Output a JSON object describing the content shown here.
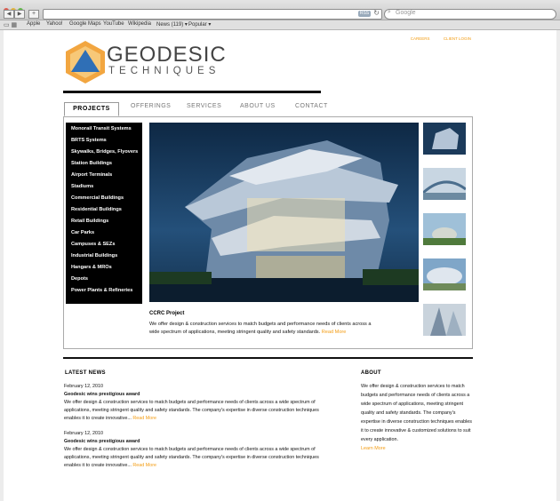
{
  "browser": {
    "search_placeholder": "Google",
    "rss_label": "RSS",
    "bookmarks": [
      "Apple",
      "Yahoo!",
      "Google Maps",
      "YouTube",
      "Wikipedia",
      "News (119) ▾",
      "Popular ▾"
    ]
  },
  "site": {
    "top_links": [
      "CAREERS",
      "CLIENT LOGIN"
    ],
    "brand_line1": "GEODESIC",
    "brand_line2": "TECHNIQUES",
    "colors": {
      "accent": "#f39c12",
      "logo_blue": "#2f6fb6",
      "logo_orange": "#f2a640"
    }
  },
  "tabs": [
    "PROJECTS",
    "OFFERINGS",
    "SERVICES",
    "ABOUT US",
    "CONTACT"
  ],
  "sidenav": [
    "Monorail Transit Systems",
    "BRTS Systems",
    "Skywalks, Bridges, Flyovers",
    "Station Buildings",
    "Airport Terminals",
    "Stadiums",
    "Commercial Buildings",
    "Residential Buildings",
    "Retail Buildings",
    "Car Parks",
    "Campuses & SEZs",
    "Industrial Buildings",
    "Hangars & MROs",
    "Depots",
    "Power Plants & Refineries"
  ],
  "feature": {
    "title": "CCRC Project",
    "text": "We offer design & construction services to match budgets and performance needs of clients across a wide spectrum of applications, meeting stringent quality and safety standards.",
    "read_more": "Read More"
  },
  "latest_news": {
    "heading": "LATEST NEWS",
    "items": [
      {
        "date": "February 12, 2010",
        "title": "Geodesic wins prestigious award",
        "text": "We offer design & construction services to match budgets and performance needs of clients across a wide spectrum of applications, meeting stringent quality and safety standards. The company's expertise in diverse construction techniques enables it to create innovative...",
        "read_more": "Read More"
      },
      {
        "date": "February 12, 2010",
        "title": "Geodesic wins prestigious award",
        "text": "We offer design & construction services to match budgets and performance needs of clients across a wide spectrum of applications, meeting stringent quality and safety standards. The company's expertise in diverse construction techniques enables it to create innovative...",
        "read_more": "Read More"
      }
    ]
  },
  "about": {
    "heading": "ABOUT",
    "text": "We offer design & construction services to match budgets and performance needs of clients across a wide spectrum of applications, meeting stringent quality and safety standards. The company's expertise in diverse construction techniques enables it to create innovative & customized solutions to suit every application.",
    "learn_more": "Learn More"
  }
}
